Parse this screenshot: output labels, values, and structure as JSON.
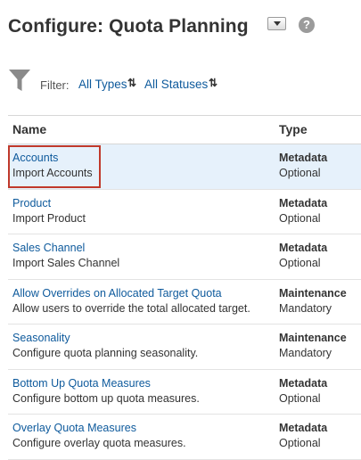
{
  "header": {
    "title": "Configure: Quota Planning",
    "menu_icon": "dropdown-arrow-icon",
    "help_icon": "help-icon",
    "help_glyph": "?"
  },
  "filter": {
    "icon": "funnel-icon",
    "label": "Filter:",
    "types_link": "All Types",
    "statuses_link": "All Statuses",
    "swap_icon": "swap-icon"
  },
  "table": {
    "columns": {
      "name": "Name",
      "type": "Type"
    },
    "rows": [
      {
        "name": "Accounts",
        "description": "Import Accounts",
        "type": "Metadata",
        "requirement": "Optional"
      },
      {
        "name": "Product",
        "description": "Import Product",
        "type": "Metadata",
        "requirement": "Optional"
      },
      {
        "name": "Sales Channel",
        "description": "Import Sales Channel",
        "type": "Metadata",
        "requirement": "Optional"
      },
      {
        "name": "Allow Overrides on Allocated Target Quota",
        "description": "Allow users to override the total allocated target.",
        "type": "Maintenance",
        "requirement": "Mandatory"
      },
      {
        "name": "Seasonality",
        "description": "Configure quota planning seasonality.",
        "type": "Maintenance",
        "requirement": "Mandatory"
      },
      {
        "name": "Bottom Up Quota Measures",
        "description": "Configure bottom up quota measures.",
        "type": "Metadata",
        "requirement": "Optional"
      },
      {
        "name": "Overlay Quota Measures",
        "description": "Configure overlay quota measures.",
        "type": "Metadata",
        "requirement": "Optional"
      }
    ]
  },
  "colors": {
    "link": "#0e5a9c",
    "selected_row": "#e6f1fb",
    "focus_border": "#c0392b"
  }
}
